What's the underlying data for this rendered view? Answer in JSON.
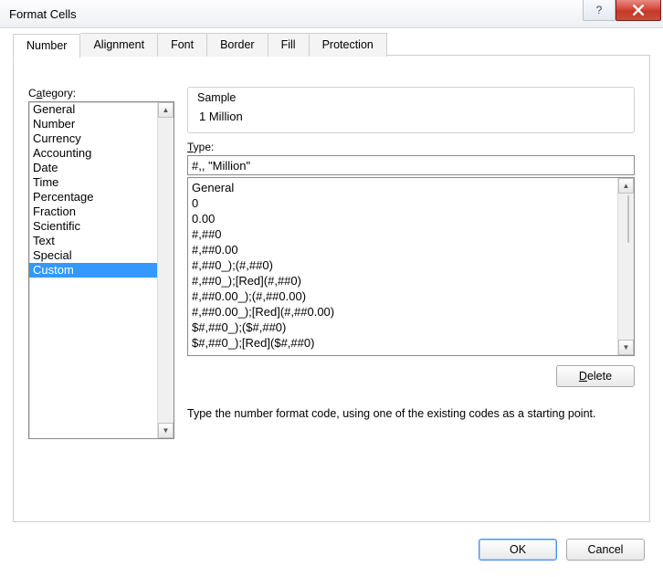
{
  "window": {
    "title": "Format Cells"
  },
  "tabs": [
    {
      "label": "Number",
      "active": true
    },
    {
      "label": "Alignment",
      "active": false
    },
    {
      "label": "Font",
      "active": false
    },
    {
      "label": "Border",
      "active": false
    },
    {
      "label": "Fill",
      "active": false
    },
    {
      "label": "Protection",
      "active": false
    }
  ],
  "category": {
    "label_pre": "C",
    "label_u": "a",
    "label_post": "tegory:",
    "items": [
      "General",
      "Number",
      "Currency",
      "Accounting",
      "Date",
      "Time",
      "Percentage",
      "Fraction",
      "Scientific",
      "Text",
      "Special",
      "Custom"
    ],
    "selected": "Custom"
  },
  "sample": {
    "legend": "Sample",
    "value": "1 Million"
  },
  "type": {
    "label_u": "T",
    "label_post": "ype:",
    "input_value": "#,, \"Million\"",
    "list": [
      "General",
      "0",
      "0.00",
      "#,##0",
      "#,##0.00",
      "#,##0_);(#,##0)",
      "#,##0_);[Red](#,##0)",
      "#,##0.00_);(#,##0.00)",
      "#,##0.00_);[Red](#,##0.00)",
      "$#,##0_);($#,##0)",
      "$#,##0_);[Red]($#,##0)"
    ]
  },
  "buttons": {
    "delete_u": "D",
    "delete_post": "elete",
    "ok": "OK",
    "cancel": "Cancel"
  },
  "hint": "Type the number format code, using one of the existing codes as a starting point."
}
